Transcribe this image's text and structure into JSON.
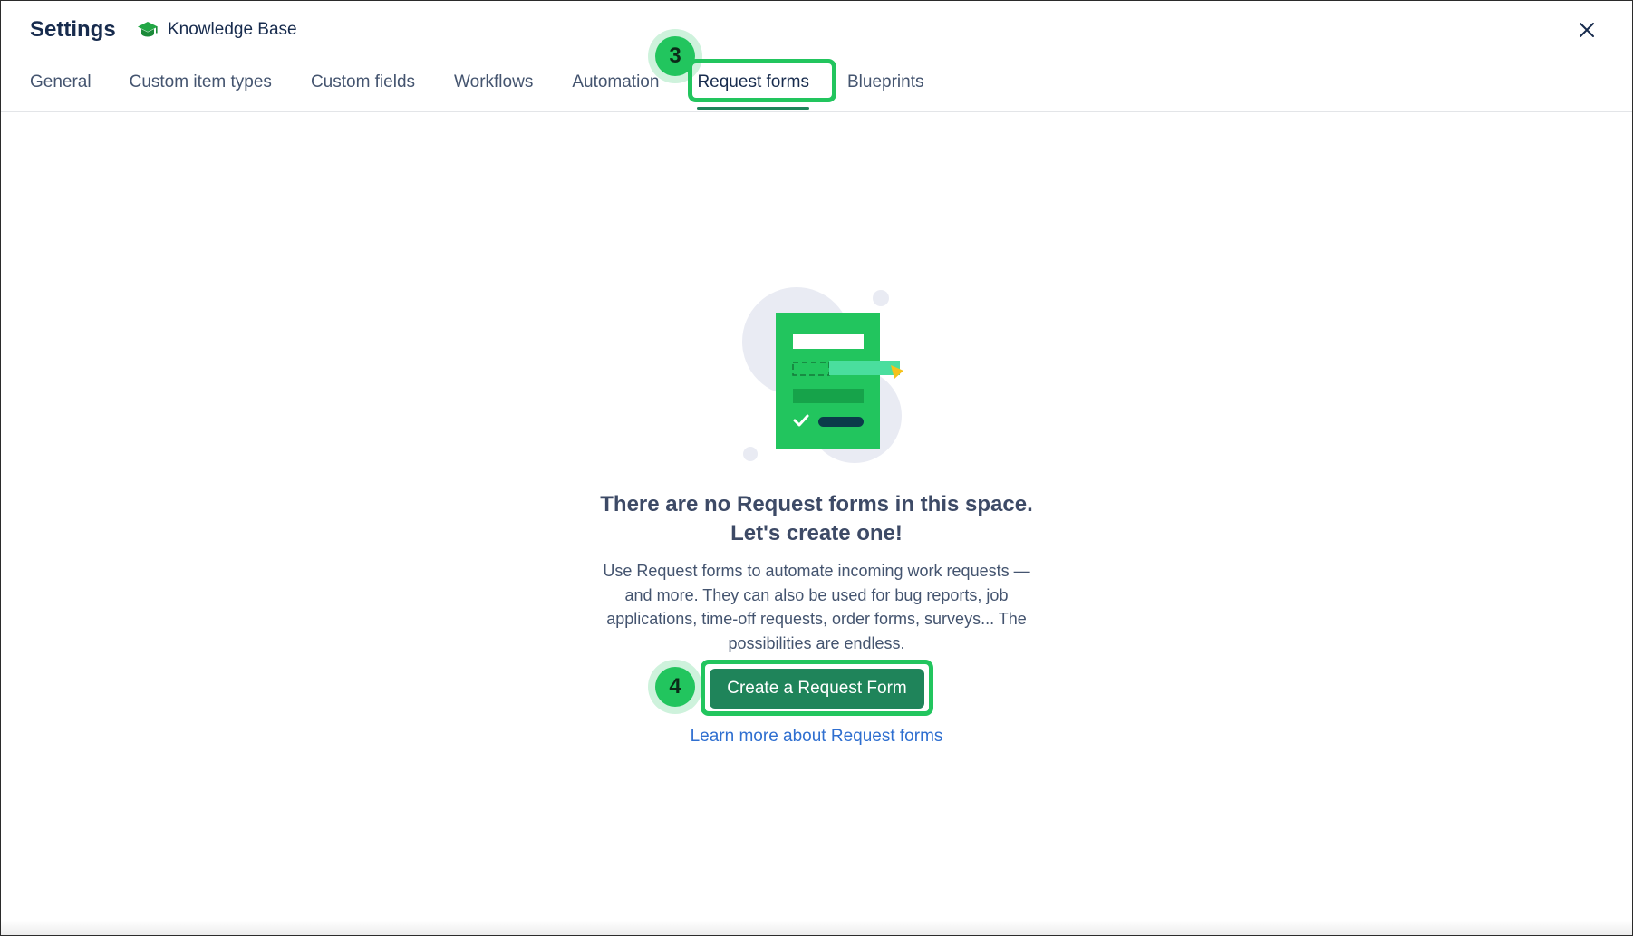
{
  "header": {
    "title": "Settings",
    "space_name": "Knowledge Base",
    "space_icon": "graduation-cap-icon",
    "close_icon": "close-icon"
  },
  "tabs": [
    {
      "label": "General",
      "active": false
    },
    {
      "label": "Custom item types",
      "active": false
    },
    {
      "label": "Custom fields",
      "active": false
    },
    {
      "label": "Workflows",
      "active": false
    },
    {
      "label": "Automation",
      "active": false
    },
    {
      "label": "Request forms",
      "active": true
    },
    {
      "label": "Blueprints",
      "active": false
    }
  ],
  "annotations": {
    "step_tab": "3",
    "step_button": "4",
    "highlight_color": "#22c55e"
  },
  "empty_state": {
    "heading_line1": "There are no Request forms in this space.",
    "heading_line2": "Let's create one!",
    "description_line1": "Use Request forms to automate incoming work requests —",
    "description_line2": "and more. They can also be used for bug reports, job",
    "description_line3": "applications, time-off requests, order forms, surveys... The",
    "description_line4": "possibilities are endless.",
    "create_button": "Create a Request Form",
    "learn_link": "Learn more about Request forms"
  },
  "colors": {
    "accent_green": "#1f845a",
    "link_blue": "#2f6fd0",
    "illustration_green": "#22c55e"
  }
}
